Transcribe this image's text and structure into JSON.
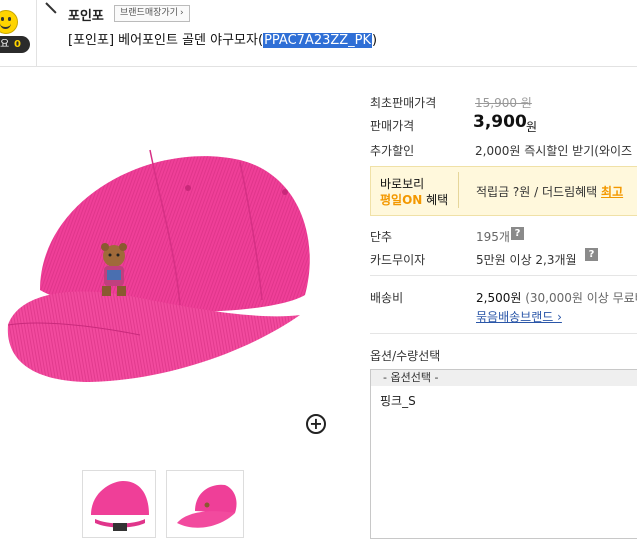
{
  "header": {
    "counter_prefix": "요",
    "counter_value": "0",
    "brand_name": "포인포",
    "brand_store_link": "브랜드매장가기",
    "brand_store_arrow": "›",
    "title_prefix": "[포인포] 베어포인트 골덴 야구모자(",
    "product_code": "PPAC7A23ZZ_PK",
    "title_suffix": ")"
  },
  "product": {
    "main_image": "pink-corduroy-baseball-cap-with-bear-patch",
    "zoom_icon_label": "+",
    "thumbnails": [
      "pink-cap-back-view",
      "pink-cap-side-view"
    ],
    "cap_color": "#f0419a"
  },
  "pricing": {
    "original_label": "최초판매가격",
    "original_value": "15,900 원",
    "sale_label": "판매가격",
    "sale_value": "3,900",
    "sale_unit": "원",
    "extra_label": "추가할인",
    "extra_value": "2,000원 즉시할인 받기(와이즈"
  },
  "promo": {
    "line1": "바로보리",
    "line2_highlight": "평일ON",
    "line2_rest": " 혜택",
    "text": "적립금 ?원 / 더드림혜택 ",
    "link": "최고"
  },
  "info": {
    "unit_label": "단추",
    "unit_value": "195개",
    "card_label": "카드무이자",
    "card_value": "5만원 이상 2,3개월",
    "help_icon": "?"
  },
  "shipping": {
    "label": "배송비",
    "value": "2,500원",
    "note": " (30,000원 이상 무료배",
    "bundle_link": "묶음배송브랜드 ›"
  },
  "options": {
    "label": "옵션/수량선택",
    "select_placeholder": "- 옵션선택 -",
    "items": [
      "핑크_S"
    ]
  },
  "colors": {
    "accent_orange": "#f39800",
    "link_blue": "#2a56a8",
    "selection_blue": "#2f6fd6",
    "promo_bg": "#fff8dc"
  }
}
